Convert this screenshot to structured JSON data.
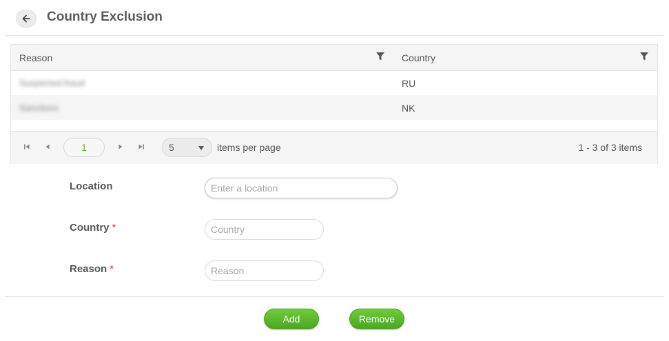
{
  "header": {
    "title": "Country Exclusion"
  },
  "grid": {
    "columns": [
      "Reason",
      "Country"
    ],
    "rows": [
      {
        "reason": "Suspected fraud",
        "country": "RU"
      },
      {
        "reason": "Sanctions",
        "country": "NK"
      }
    ],
    "pager": {
      "current_page": "1",
      "page_size": "5",
      "items_per_page_label": "items per page",
      "range_text": "1 - 3 of 3 items"
    }
  },
  "form": {
    "location_label": "Location",
    "location_placeholder": "Enter a location",
    "country_label": "Country",
    "country_placeholder": "Country",
    "reason_label": "Reason",
    "reason_placeholder": "Reason",
    "required_mark": "*"
  },
  "actions": {
    "add_label": "Add",
    "remove_label": "Remove"
  },
  "colors": {
    "accent_green": "#5cb82e",
    "required_red": "#e53935"
  }
}
